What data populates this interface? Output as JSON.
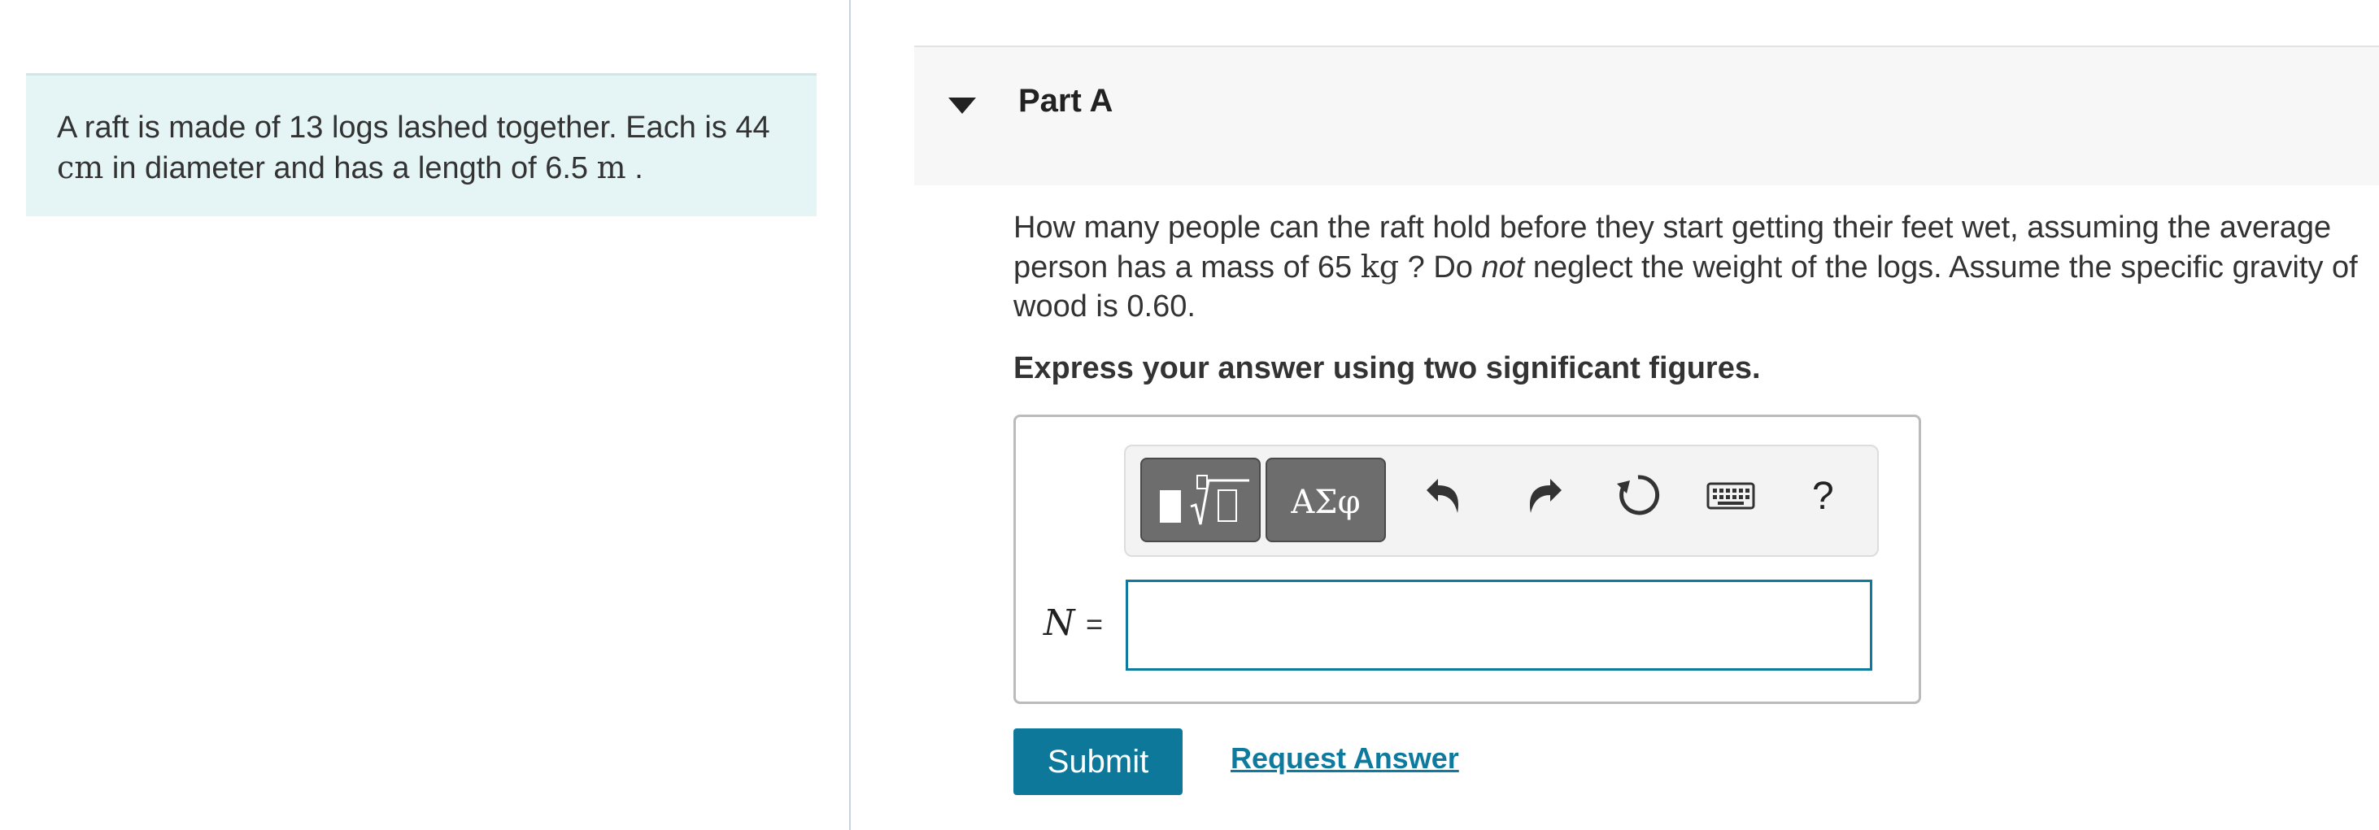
{
  "intro": {
    "sentence_1": "A raft is made of 13 logs lashed together. Each is",
    "diameter_value": "44",
    "diameter_unit": "cm",
    "diameter_text": "in diameter and has a length of 6.5",
    "length_unit": "m",
    "end": "."
  },
  "part": {
    "title": "Part A",
    "question": {
      "text_1": "How many people can the raft hold before they start getting their feet wet, assuming the average person has a mass of 65",
      "mass_unit": "kg",
      "text_2": "? Do",
      "emphasis": "not",
      "text_3": "neglect the weight of the logs. Assume the specific gravity of wood is 0.60."
    },
    "instruction": "Express your answer using two significant figures."
  },
  "answer": {
    "variable": "N",
    "equals": "=",
    "value": "",
    "toolbar": {
      "symbols_label": "ΑΣφ",
      "help_label": "?",
      "icons": [
        "templates-icon",
        "undo-icon",
        "redo-icon",
        "reset-icon",
        "keyboard-icon",
        "help-icon"
      ]
    }
  },
  "actions": {
    "submit_label": "Submit",
    "request_answer_label": "Request Answer"
  },
  "colors": {
    "intro_bg": "#e5f4f4",
    "accent": "#0e789a",
    "header_bg": "#f7f7f7"
  }
}
